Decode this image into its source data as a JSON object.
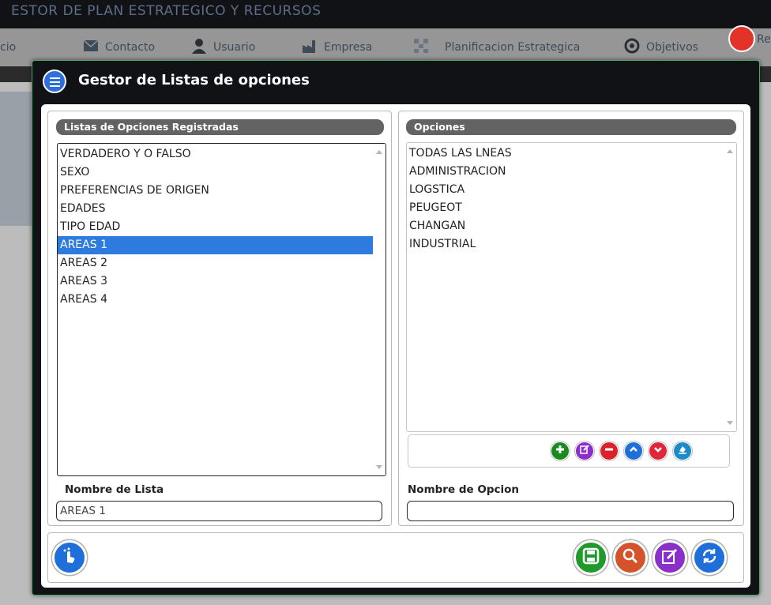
{
  "background": {
    "app_title": "ESTOR DE PLAN ESTRATEGICO Y RECURSOS",
    "nav": [
      {
        "label": "cio",
        "icon": "home-icon"
      },
      {
        "label": "Contacto",
        "icon": "mail-icon"
      },
      {
        "label": "Usuario",
        "icon": "user-icon"
      },
      {
        "label": "Empresa",
        "icon": "factory-icon"
      },
      {
        "label": "Planificacion Estrategica",
        "icon": "network-icon"
      },
      {
        "label": "Objetivos",
        "icon": "target-icon"
      }
    ],
    "right_nav_label": "Re"
  },
  "modal": {
    "title": "Gestor de Listas de opciones",
    "icon": "list-icon",
    "lists_panel": {
      "header": "Listas de Opciones Registradas",
      "items": [
        "VERDADERO Y O FALSO",
        "SEXO",
        "PREFERENCIAS DE ORIGEN",
        "EDADES",
        "TIPO EDAD",
        "AREAS 1",
        "AREAS 2",
        "AREAS 3",
        "AREAS 4"
      ],
      "selected": "AREAS 1",
      "name_label": "Nombre de Lista",
      "name_value": "AREAS 1"
    },
    "options_panel": {
      "header": "Opciones",
      "items": [
        "TODAS LAS LNEAS",
        "ADMINISTRACION",
        "LOGSTICA",
        "PEUGEOT",
        "CHANGAN",
        "INDUSTRIAL"
      ],
      "name_label": "Nombre de Opcion",
      "name_value": "",
      "toolbar": [
        {
          "name": "add-option-button",
          "icon": "plus-icon",
          "color": "#1a8a1f"
        },
        {
          "name": "edit-option-button",
          "icon": "edit-icon",
          "color": "#8a2fc9"
        },
        {
          "name": "remove-option-button",
          "icon": "minus-icon",
          "color": "#d9222a"
        },
        {
          "name": "move-up-button",
          "icon": "chevron-up-icon",
          "color": "#1e6fd9"
        },
        {
          "name": "move-down-button",
          "icon": "chevron-down-icon",
          "color": "#e0263a"
        },
        {
          "name": "clear-option-button",
          "icon": "eraser-icon",
          "color": "#1a8ac9"
        }
      ]
    },
    "footer": {
      "help_icon": "touch-hand-icon",
      "actions": [
        {
          "name": "save-button",
          "icon": "save-icon",
          "color": "#1f9a2b"
        },
        {
          "name": "search-button",
          "icon": "search-icon",
          "color": "#d4532a"
        },
        {
          "name": "edit-button",
          "icon": "edit-icon",
          "color": "#8a2fc9"
        },
        {
          "name": "refresh-button",
          "icon": "refresh-icon",
          "color": "#1e6fd9"
        }
      ]
    }
  }
}
